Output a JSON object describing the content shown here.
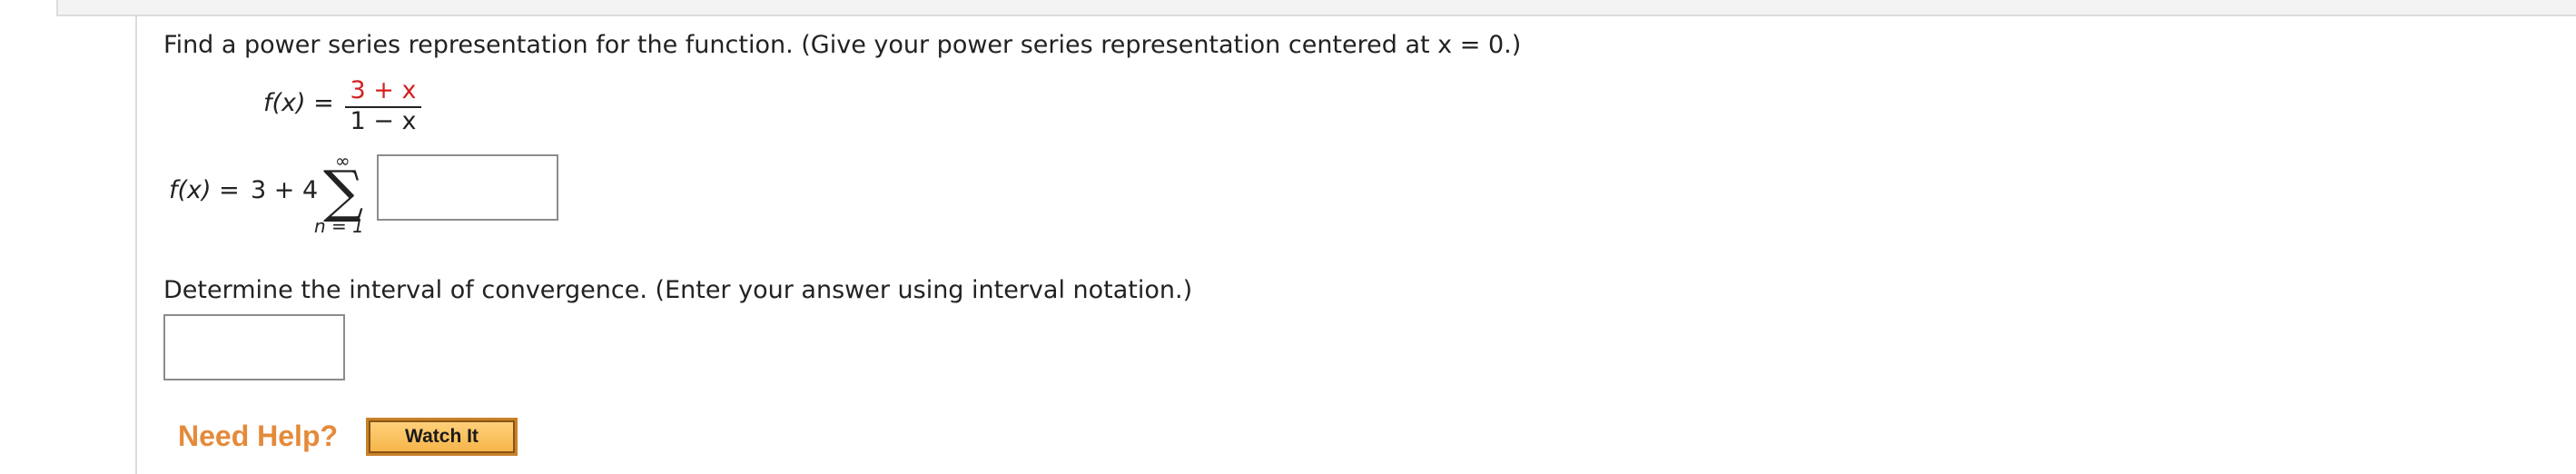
{
  "question": {
    "prompt": "Find a power series representation for the function. (Give your power series representation centered at x = 0.)",
    "definition": {
      "lhs": "f(x) = ",
      "numerator": "3 + x",
      "denominator": "1 − x"
    },
    "series": {
      "lhs": "f(x) = ",
      "leading_terms": "3 + 4",
      "upper_limit": "∞",
      "sigma": "∑",
      "lower_limit": "n = 1",
      "answer_value": ""
    },
    "interval": {
      "prompt": "Determine the interval of convergence. (Enter your answer using interval notation.)",
      "answer_value": ""
    }
  },
  "help": {
    "label": "Need Help?",
    "watch_button": "Watch It"
  },
  "colors": {
    "highlight_red": "#d42020",
    "help_orange": "#e48a3a",
    "button_fill": "#f6b54a"
  }
}
